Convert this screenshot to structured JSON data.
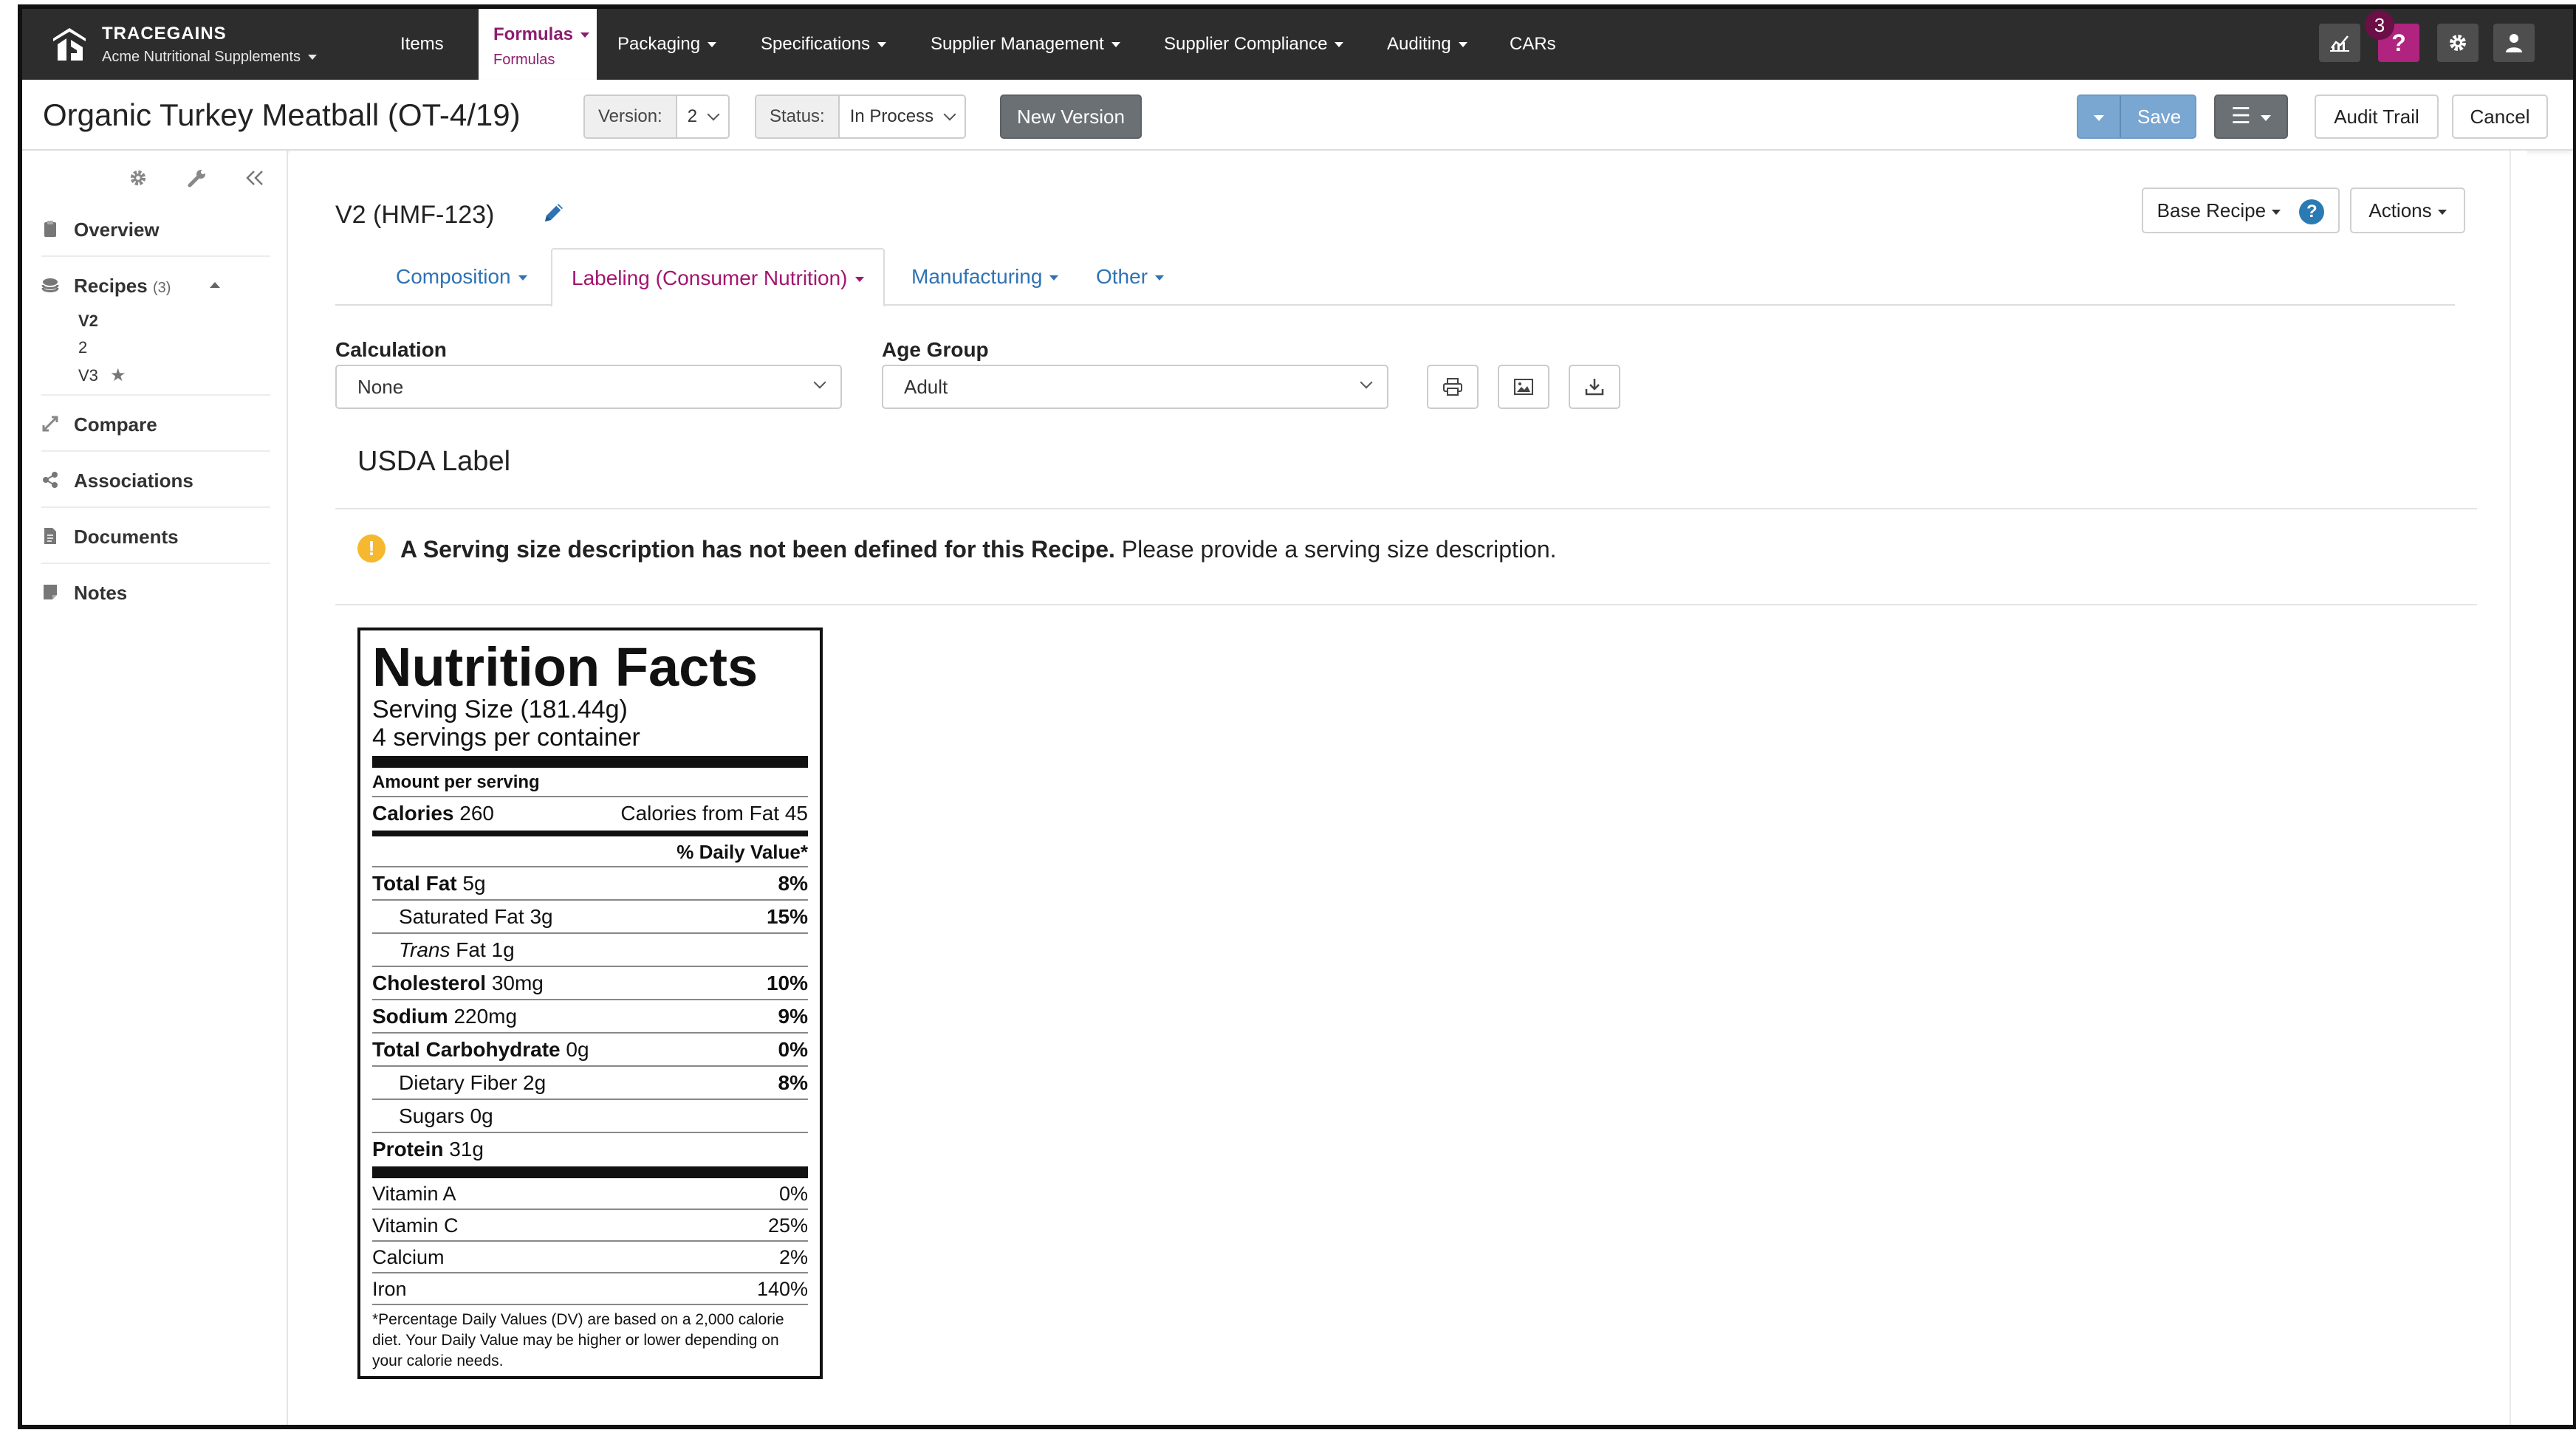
{
  "app": {
    "brand_name": "TRACEGAINS",
    "org_name": "Acme Nutritional Supplements",
    "notification_count": "3"
  },
  "nav": {
    "items": [
      "Items",
      "Formulas",
      "Packaging",
      "Specifications",
      "Supplier Management",
      "Supplier Compliance",
      "Auditing",
      "CARs"
    ],
    "active_sub": "Formulas"
  },
  "titlebar": {
    "title": "Organic Turkey Meatball (OT-4/19)",
    "version_label": "Version:",
    "version_value": "2",
    "status_label": "Status:",
    "status_value": "In Process",
    "new_version": "New Version",
    "save": "Save",
    "audit_trail": "Audit Trail",
    "cancel": "Cancel"
  },
  "sidebar": {
    "items": [
      {
        "label": "Overview",
        "icon": "clipboard-icon"
      },
      {
        "label": "Recipes",
        "count": "(3)",
        "icon": "layers-icon"
      },
      {
        "label": "Compare",
        "icon": "compare-icon"
      },
      {
        "label": "Associations",
        "icon": "share-icon"
      },
      {
        "label": "Documents",
        "icon": "document-icon"
      },
      {
        "label": "Notes",
        "icon": "note-icon"
      }
    ],
    "recipes": [
      "V2",
      "2",
      "V3"
    ]
  },
  "main": {
    "recipe_title": "V2 (HMF-123)",
    "base_recipe": "Base Recipe",
    "actions": "Actions",
    "tabs": [
      "Composition",
      "Labeling (Consumer Nutrition)",
      "Manufacturing",
      "Other"
    ],
    "calculation_label": "Calculation",
    "calculation_value": "None",
    "age_group_label": "Age Group",
    "age_group_value": "Adult",
    "section_title": "USDA Label",
    "warning_bold": "A Serving size description has not been defined for this Recipe.",
    "warning_rest": " Please provide a serving size description."
  },
  "nutrition": {
    "title": "Nutrition Facts",
    "serving_size": "Serving Size (181.44g)",
    "servings": "4 servings per container",
    "amount_per_serving": "Amount per serving",
    "calories_label": "Calories",
    "calories_value": "260",
    "calories_fat": "Calories from Fat 45",
    "dv_header": "% Daily Value*",
    "rows": [
      {
        "name": "Total Fat",
        "amount": "5g",
        "dv": "8%",
        "bold": true,
        "indent": false
      },
      {
        "name": "Saturated Fat",
        "amount": "3g",
        "dv": "15%",
        "bold": false,
        "indent": true
      },
      {
        "name": "Trans",
        "amount": "Fat 1g",
        "dv": "",
        "bold": false,
        "indent": true
      },
      {
        "name": "Cholesterol",
        "amount": "30mg",
        "dv": "10%",
        "bold": true,
        "indent": false
      },
      {
        "name": "Sodium",
        "amount": "220mg",
        "dv": "9%",
        "bold": true,
        "indent": false
      },
      {
        "name": "Total Carbohydrate",
        "amount": "0g",
        "dv": "0%",
        "bold": true,
        "indent": false
      },
      {
        "name": "Dietary Fiber",
        "amount": "2g",
        "dv": "8%",
        "bold": false,
        "indent": true
      },
      {
        "name": "Sugars",
        "amount": "0g",
        "dv": "",
        "bold": false,
        "indent": true
      },
      {
        "name": "Protein",
        "amount": "31g",
        "dv": "",
        "bold": true,
        "indent": false
      }
    ],
    "vitamins": [
      {
        "name": "Vitamin A",
        "dv": "0%"
      },
      {
        "name": "Vitamin C",
        "dv": "25%"
      },
      {
        "name": "Calcium",
        "dv": "2%"
      },
      {
        "name": "Iron",
        "dv": "140%"
      }
    ],
    "footnote": "*Percentage Daily Values (DV) are based on a 2,000 calorie diet. Your Daily Value may be higher or lower depending on your calorie needs."
  },
  "colors": {
    "nav_bg": "#2d2d2d",
    "accent_magenta": "#a3166e",
    "link_blue": "#2f73b3",
    "save_blue": "#7aa6d2",
    "warning_yellow": "#f5b82e"
  }
}
